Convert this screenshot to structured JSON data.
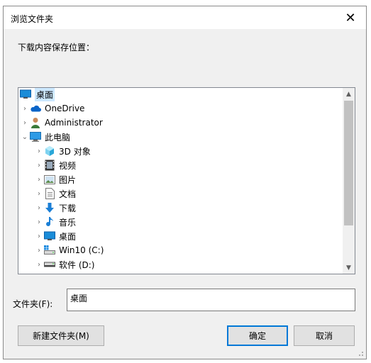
{
  "dialog": {
    "title": "浏览文件夹",
    "close_glyph": "✕",
    "prompt": "下载内容保存位置：",
    "folder_label": "文件夹(F):",
    "folder_value": "桌面",
    "new_folder_label": "新建文件夹(M)",
    "ok_label": "确定",
    "cancel_label": "取消"
  },
  "tree": {
    "items": [
      {
        "label": "桌面",
        "icon": "desktop-icon",
        "chevron": "",
        "level": 0,
        "selected": true
      },
      {
        "label": "OneDrive",
        "icon": "cloud-icon",
        "chevron": "›",
        "level": 1
      },
      {
        "label": "Administrator",
        "icon": "user-icon",
        "chevron": "›",
        "level": 1
      },
      {
        "label": "此电脑",
        "icon": "computer-icon",
        "chevron": "⌄",
        "level": 1
      },
      {
        "label": "3D 对象",
        "icon": "3d-objects-icon",
        "chevron": "›",
        "level": 2
      },
      {
        "label": "视频",
        "icon": "video-icon",
        "chevron": "›",
        "level": 2
      },
      {
        "label": "图片",
        "icon": "pictures-icon",
        "chevron": "›",
        "level": 2
      },
      {
        "label": "文档",
        "icon": "documents-icon",
        "chevron": "›",
        "level": 2
      },
      {
        "label": "下载",
        "icon": "download-icon",
        "chevron": "›",
        "level": 2
      },
      {
        "label": "音乐",
        "icon": "music-icon",
        "chevron": "›",
        "level": 2
      },
      {
        "label": "桌面",
        "icon": "desktop-icon",
        "chevron": "›",
        "level": 2
      },
      {
        "label": "Win10 (C:)",
        "icon": "system-drive-icon",
        "chevron": "›",
        "level": 2
      },
      {
        "label": "软件 (D:)",
        "icon": "drive-icon",
        "chevron": "›",
        "level": 2
      }
    ]
  },
  "scrollbar": {
    "up_glyph": "▲",
    "down_glyph": "▼"
  },
  "colors": {
    "selection": "#cce8ff",
    "accent": "#0078d7",
    "onedrive": "#0a64c8"
  }
}
